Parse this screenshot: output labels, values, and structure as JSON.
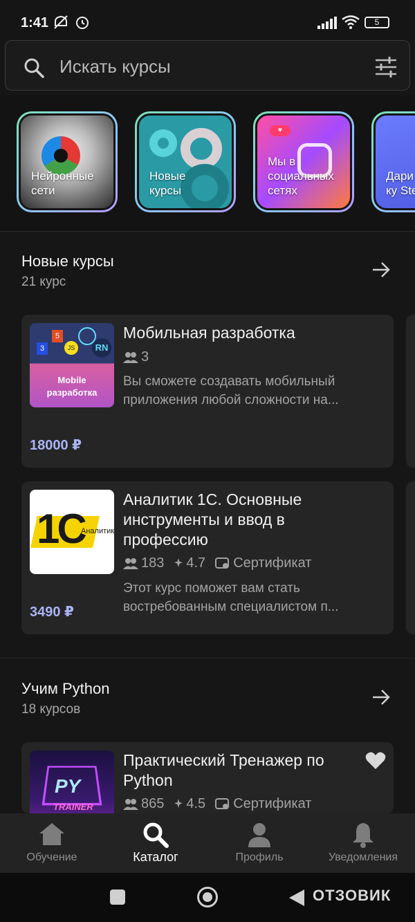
{
  "status": {
    "time": "1:41",
    "battery": "5"
  },
  "search": {
    "placeholder": "Искать курсы"
  },
  "stories": [
    {
      "label": "Нейронные сети"
    },
    {
      "label": "Новые курсы"
    },
    {
      "label": "Мы в социальных сетях"
    },
    {
      "label": "Дари й-ку Stepi"
    }
  ],
  "sections": [
    {
      "title": "Новые курсы",
      "count": "21 курс",
      "cards": [
        {
          "thumb_text": "Mobile разработка",
          "thumb_badges": [
            "5",
            "RN",
            "JS",
            "3"
          ],
          "title": "Мобильная разработка",
          "learners": "3",
          "description_lines": [
            "Вы сможете создавать мобильный",
            "приложения любой сложности на..."
          ],
          "price": "18000 ₽"
        },
        {
          "thumb_text": "1С",
          "thumb_sub": "Аналитик",
          "title_lines": [
            "Аналитик 1С. Основные",
            "инструменты и ввод в",
            "профессию"
          ],
          "learners": "183",
          "rating": "4.7",
          "certificate": "Сертификат",
          "description_lines": [
            "Этот курс поможет вам стать",
            "востребованным специалистом п..."
          ],
          "price": "3490 ₽"
        }
      ]
    },
    {
      "title": "Учим Python",
      "count": "18 курсов",
      "cards": [
        {
          "thumb_text": "PY",
          "thumb_sub": "TRAINER",
          "title_lines": [
            "Практический Тренажер по",
            "Python"
          ],
          "learners": "865",
          "rating": "4.5",
          "certificate": "Сертификат"
        }
      ]
    }
  ],
  "bottom_nav": [
    {
      "label": "Обучение",
      "icon": "home-icon"
    },
    {
      "label": "Каталог",
      "icon": "search-icon"
    },
    {
      "label": "Профиль",
      "icon": "profile-icon"
    },
    {
      "label": "Уведомления",
      "icon": "bell-icon"
    }
  ],
  "watermark": "ОТЗОВИК",
  "colors": {
    "accent_price": "#a9b4f5",
    "background": "#161616",
    "card": "#252525"
  }
}
